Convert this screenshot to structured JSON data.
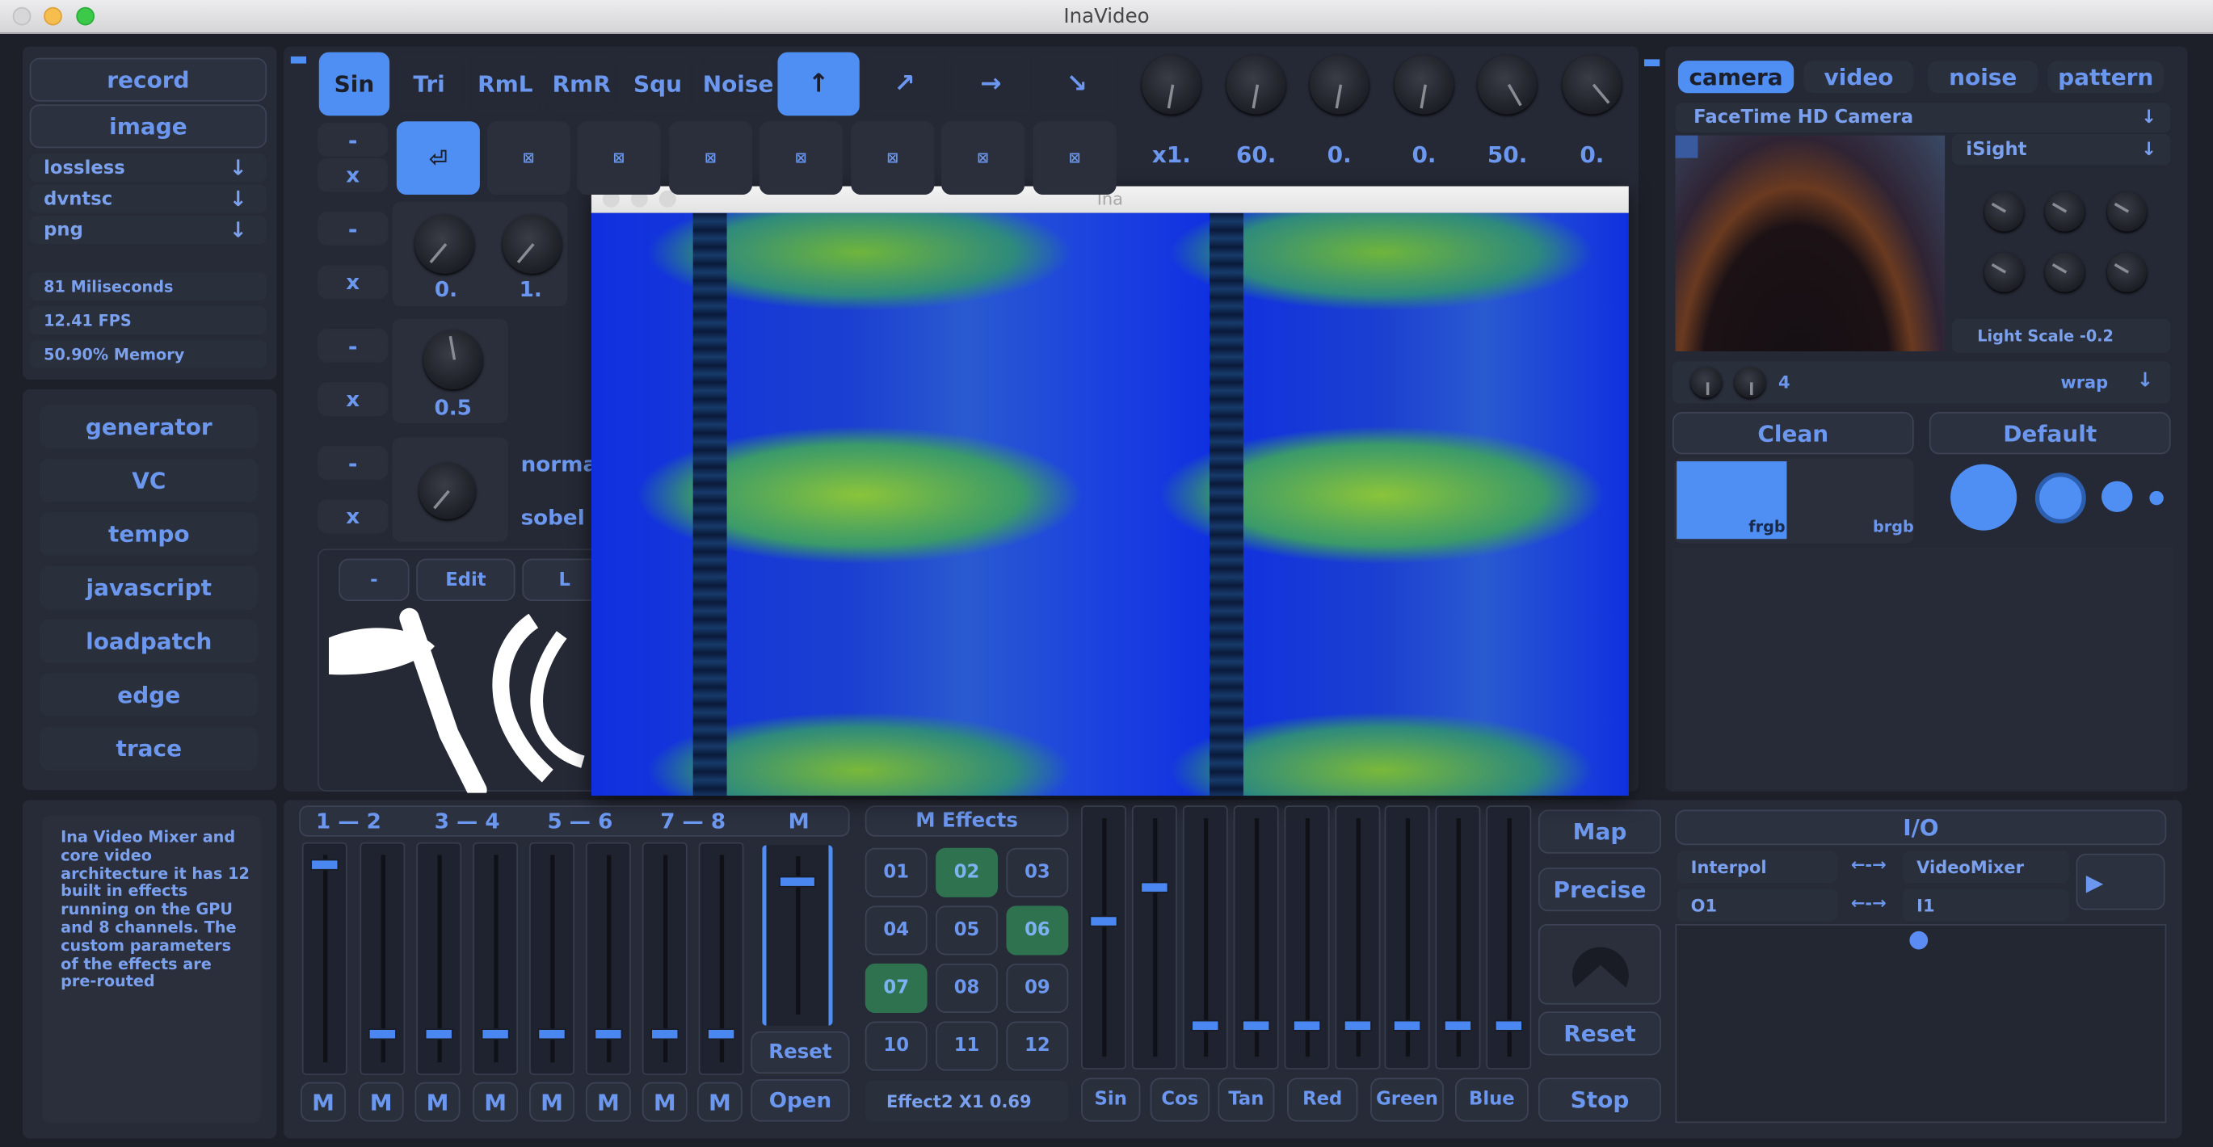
{
  "window_title": "InaVideo",
  "left_top": {
    "record": "record",
    "image": "image",
    "formats": [
      "lossless",
      "dvntsc",
      "png"
    ],
    "arrow": "↓",
    "stats": [
      "81 Miliseconds",
      "12.41 FPS",
      "50.90% Memory"
    ]
  },
  "modules": [
    "generator",
    "VC",
    "tempo",
    "javascript",
    "loadpatch",
    "edge",
    "trace"
  ],
  "description": "Ina Video Mixer and core video architecture it has 12 built in effects running on the GPU and 8 channels. The custom parameters of the effects are pre-routed",
  "waves": [
    "Sin",
    "Tri",
    "RmL",
    "RmR",
    "Squ",
    "Noise"
  ],
  "dirs": [
    "↑",
    "↗",
    "→",
    "↘"
  ],
  "enter_icon": "⏎",
  "square_icon": "⊠",
  "knob_values": [
    "x1.",
    "60.",
    "0.",
    "0.",
    "50.",
    "0."
  ],
  "dash": "-",
  "x": "x",
  "mid_vals": [
    "0.",
    "1."
  ],
  "mid_val2": "0.5",
  "side_labels": [
    "norma",
    "sobel"
  ],
  "edit_row": [
    "-",
    "Edit",
    "L"
  ],
  "float_title": "Ina",
  "right": {
    "tabs": [
      "camera",
      "video",
      "noise",
      "pattern"
    ],
    "device": "FaceTime HD Camera",
    "isight": "iSight",
    "light_scale": "Light Scale -0.2",
    "count": "4",
    "wrap": "wrap",
    "clean": "Clean",
    "default": "Default",
    "frgb": "frgb",
    "brgb": "brgb",
    "arrow": "↓"
  },
  "mixer": {
    "headers": [
      "1 — 2",
      "3 — 4",
      "5 — 6",
      "7 — 8",
      "M"
    ],
    "m": "M",
    "reset": "Reset",
    "open": "Open",
    "levels": [
      0.95,
      0.1,
      0.1,
      0.1,
      0.1,
      0.1,
      0.1,
      0.1,
      0.85
    ]
  },
  "effects": {
    "title": "M Effects",
    "nums": [
      "01",
      "02",
      "03",
      "04",
      "05",
      "06",
      "07",
      "08",
      "09",
      "10",
      "11",
      "12"
    ],
    "active": [
      "02",
      "06",
      "07"
    ],
    "status": "Effect2 X1 0.69"
  },
  "color_faders": {
    "labels": [
      "Sin",
      "Cos",
      "Tan",
      "Red",
      "Green",
      "Blue"
    ],
    "levels": [
      0.55,
      0.7,
      0.1,
      0.1,
      0.1,
      0.1,
      0.1,
      0.1,
      0.1,
      0.1
    ]
  },
  "ctrl": {
    "map": "Map",
    "precise": "Precise",
    "reset": "Reset",
    "stop": "Stop"
  },
  "io": {
    "title": "I/O",
    "rows": [
      [
        "Interpol",
        "←-→",
        "VideoMixer"
      ],
      [
        "O1",
        "←-→",
        "I1"
      ]
    ],
    "play": "▶"
  },
  "colors": {
    "accent": "#4f8ef3",
    "bg": "#1d2029",
    "panel": "#272b37",
    "green": "#2f7250"
  }
}
